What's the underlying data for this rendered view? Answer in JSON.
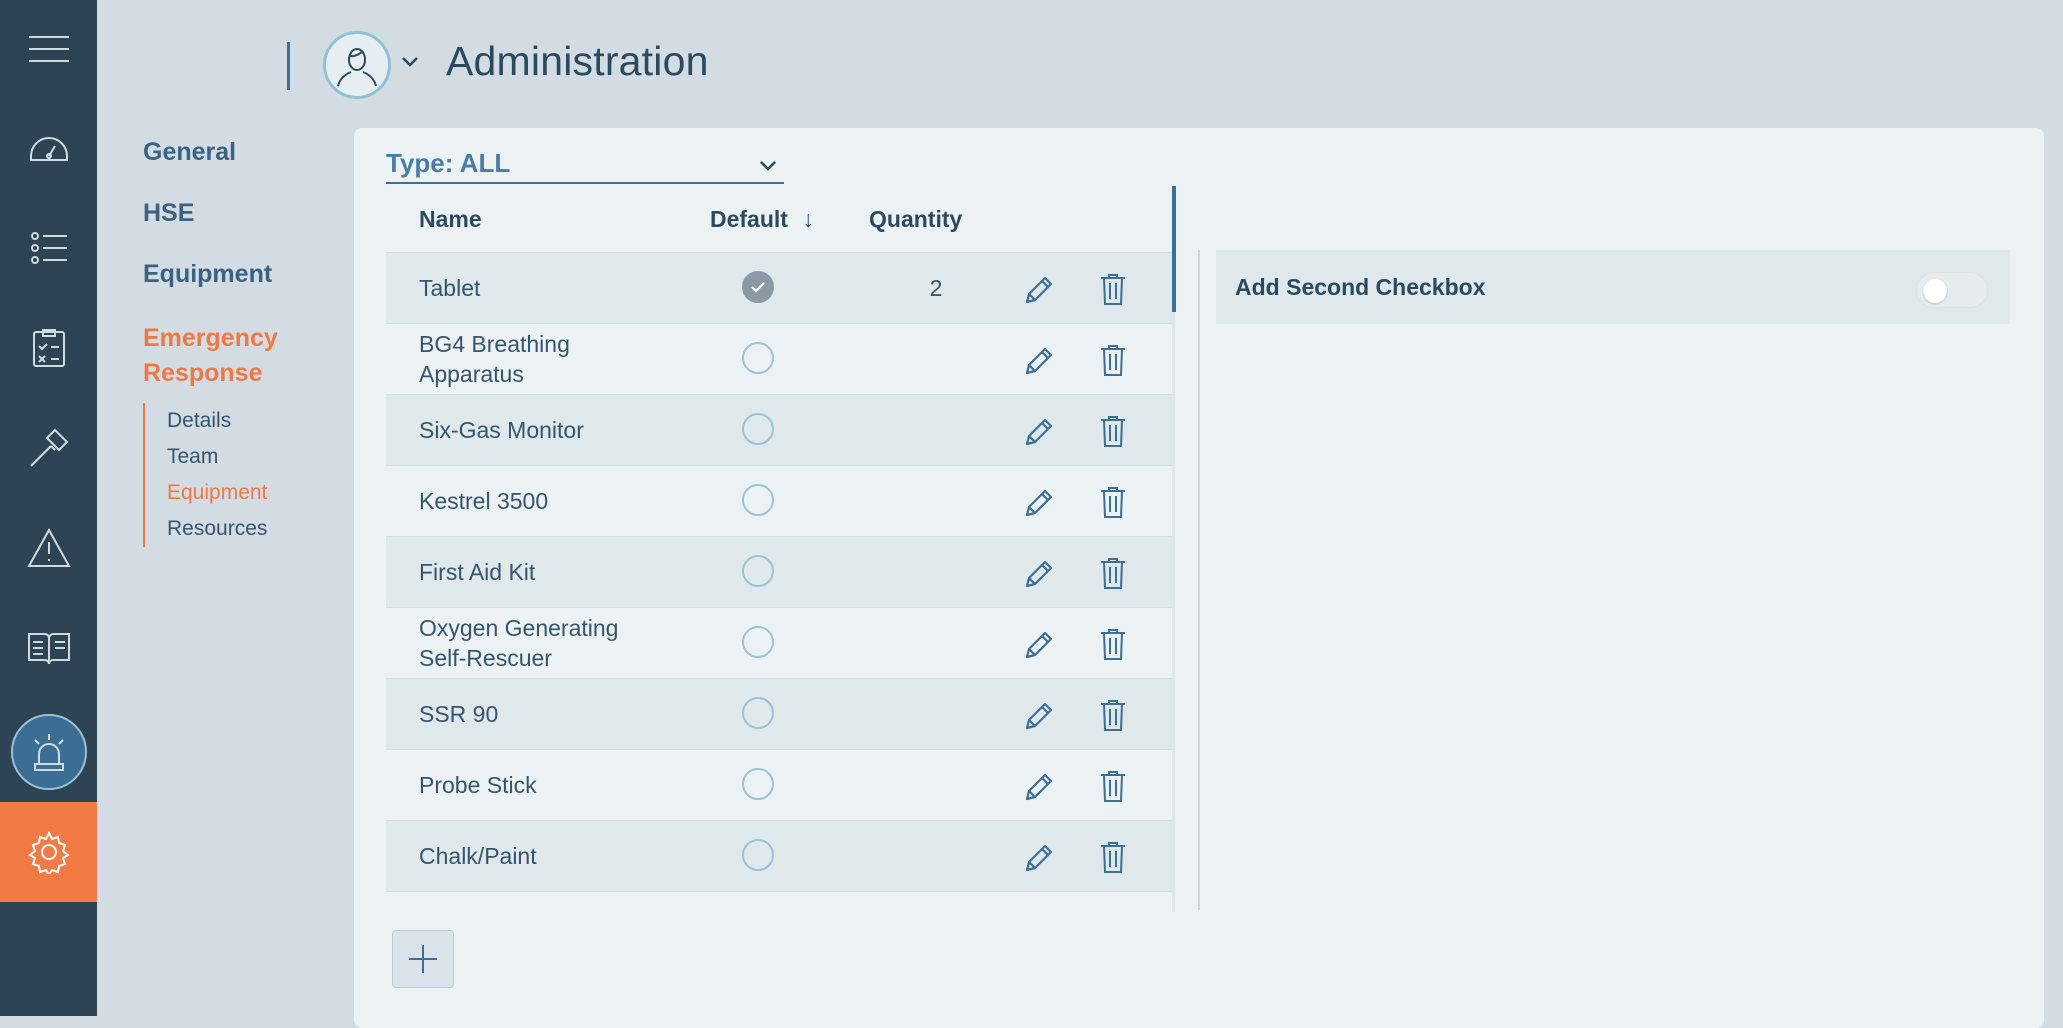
{
  "header": {
    "title": "Administration"
  },
  "rail": {
    "items": [
      {
        "icon": "menu-icon"
      },
      {
        "icon": "dashboard-icon"
      },
      {
        "icon": "list-icon"
      },
      {
        "icon": "checklist-icon"
      },
      {
        "icon": "hammer-icon"
      },
      {
        "icon": "warning-icon"
      },
      {
        "icon": "book-icon"
      },
      {
        "icon": "alarm-icon"
      },
      {
        "icon": "gear-icon"
      }
    ],
    "active_color": "#f27a45"
  },
  "subnav": {
    "items": [
      "General",
      "HSE",
      "Equipment",
      "Emergency Response"
    ],
    "active": "Emergency Response",
    "children": [
      "Details",
      "Team",
      "Equipment",
      "Resources"
    ],
    "active_child": "Equipment"
  },
  "filter": {
    "label": "Type: ALL"
  },
  "table": {
    "headers": {
      "name": "Name",
      "default": "Default",
      "sort_arrow": "↓",
      "quantity": "Quantity"
    },
    "rows": [
      {
        "name": "Tablet",
        "default": true,
        "quantity": "2"
      },
      {
        "name": "BG4 Breathing Apparatus",
        "default": false,
        "quantity": ""
      },
      {
        "name": "Six-Gas Monitor",
        "default": false,
        "quantity": ""
      },
      {
        "name": "Kestrel 3500",
        "default": false,
        "quantity": ""
      },
      {
        "name": "First Aid Kit",
        "default": false,
        "quantity": ""
      },
      {
        "name": "Oxygen Generating Self-Rescuer",
        "default": false,
        "quantity": ""
      },
      {
        "name": "SSR 90",
        "default": false,
        "quantity": ""
      },
      {
        "name": "Probe Stick",
        "default": false,
        "quantity": ""
      },
      {
        "name": "Chalk/Paint",
        "default": false,
        "quantity": ""
      },
      {
        "name": "",
        "default": false,
        "quantity": ""
      }
    ]
  },
  "options": {
    "second_checkbox_label": "Add Second Checkbox",
    "second_checkbox_on": false
  },
  "colors": {
    "accent": "#f07843",
    "primary": "#3d6e93",
    "rail": "#2e4455"
  }
}
